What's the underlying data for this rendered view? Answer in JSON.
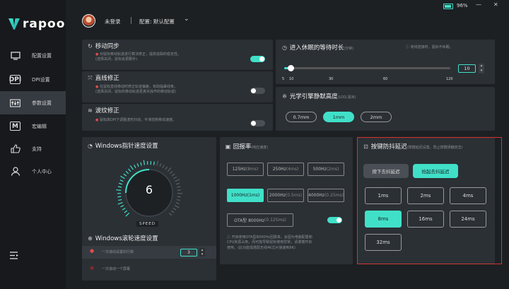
{
  "brand": {
    "name": "rapoo"
  },
  "window": {
    "battery": "96%",
    "minimize": "—",
    "close": "✕"
  },
  "nav": [
    {
      "id": "profile",
      "label": "配置设置",
      "icon": "display-icon"
    },
    {
      "id": "dpi",
      "label": "DPI设置",
      "icon": "dpi-icon"
    },
    {
      "id": "params",
      "label": "参数设置",
      "icon": "sliders-icon",
      "active": true
    },
    {
      "id": "macro",
      "label": "宏编辑",
      "icon": "macro-icon"
    },
    {
      "id": "support",
      "label": "支持",
      "icon": "thumbs-up-icon"
    },
    {
      "id": "account",
      "label": "个人中心",
      "icon": "user-icon"
    }
  ],
  "topbar": {
    "user": "未登录",
    "separator": "|",
    "config": "配置: 默认配置",
    "chevron": "⌄"
  },
  "motion_sync": {
    "title": "移动同步",
    "desc1": "对鼠标移动轨迹进行算法修正，提高追踪的稳定性。",
    "desc2": "(选择关闭，鼠标会更跟手)",
    "enabled": true
  },
  "line_fix": {
    "title": "直线修正",
    "desc1": "在鼠标直线移动时修正轨迹偏差，有助临摹线条。",
    "desc2": "(选择关闭，鼠标的移动轨迹更真实操作的移动轨迹)",
    "enabled": false
  },
  "ripple_fix": {
    "title": "波纹修正",
    "desc1": "鼠标高DPI下调整波形抖动，平滑控制移动速度。",
    "enabled": false
  },
  "sleep": {
    "title": "进入休眠的等待时长",
    "unit": "(分钟)",
    "note": "有线连接时，鼠标不休眠。",
    "value": "10",
    "ticks": [
      "5",
      "10",
      "30",
      "60",
      "120"
    ],
    "fraction": 0.04
  },
  "lod": {
    "title": "光学引擎静默高度",
    "unit": "(LOD,毫米)",
    "options": [
      "0.7mm",
      "1mm",
      "2mm"
    ],
    "selected": 1
  },
  "win_speed": {
    "title": "Windows指针速度设置",
    "value": "6",
    "speed_label": "SPEED",
    "max": 11
  },
  "scroll": {
    "title": "Windows滚轮速度设置",
    "row1": "一次滚动设置的行数",
    "row1_value": "3",
    "row2": "一次滚动一个屏幕"
  },
  "report": {
    "title": "回报率",
    "unit": "(响应速度)",
    "options": [
      "125Hz",
      "250Hz",
      "500Hz",
      "1000Hz",
      "2000Hz",
      "4000Hz"
    ],
    "times": [
      "(8ms)",
      "(4ms)",
      "(2ms)",
      "(1ms)",
      "(0.5ms)",
      "(0.25ms)"
    ],
    "selected": 3,
    "ota_label": "OTA型 8000Hz",
    "ota_time": "(0.125ms)",
    "ota_enabled": true,
    "note1": "开启使用OTA型8000Hz回报率，会因为电脑配置和",
    "note2": "CPU资源占用，而可能导致鼠标使用异常，请谨慎开启",
    "note3": "使用。(此功能需搭配无线4K芯片接速到8K)"
  },
  "debounce": {
    "title": "按键防抖延迟",
    "subtitle": "(按键延迟设置，防止按键误触双击)",
    "modes": [
      "按下去抖延迟",
      "抬起去抖延迟"
    ],
    "mode_selected": 1,
    "options": [
      "1ms",
      "2ms",
      "4ms",
      "8ms",
      "16ms",
      "24ms",
      "32ms"
    ],
    "selected": 3
  },
  "colors": {
    "accent": "#40e0c8",
    "panel": "#2b3035",
    "highlight": "#d23434"
  }
}
